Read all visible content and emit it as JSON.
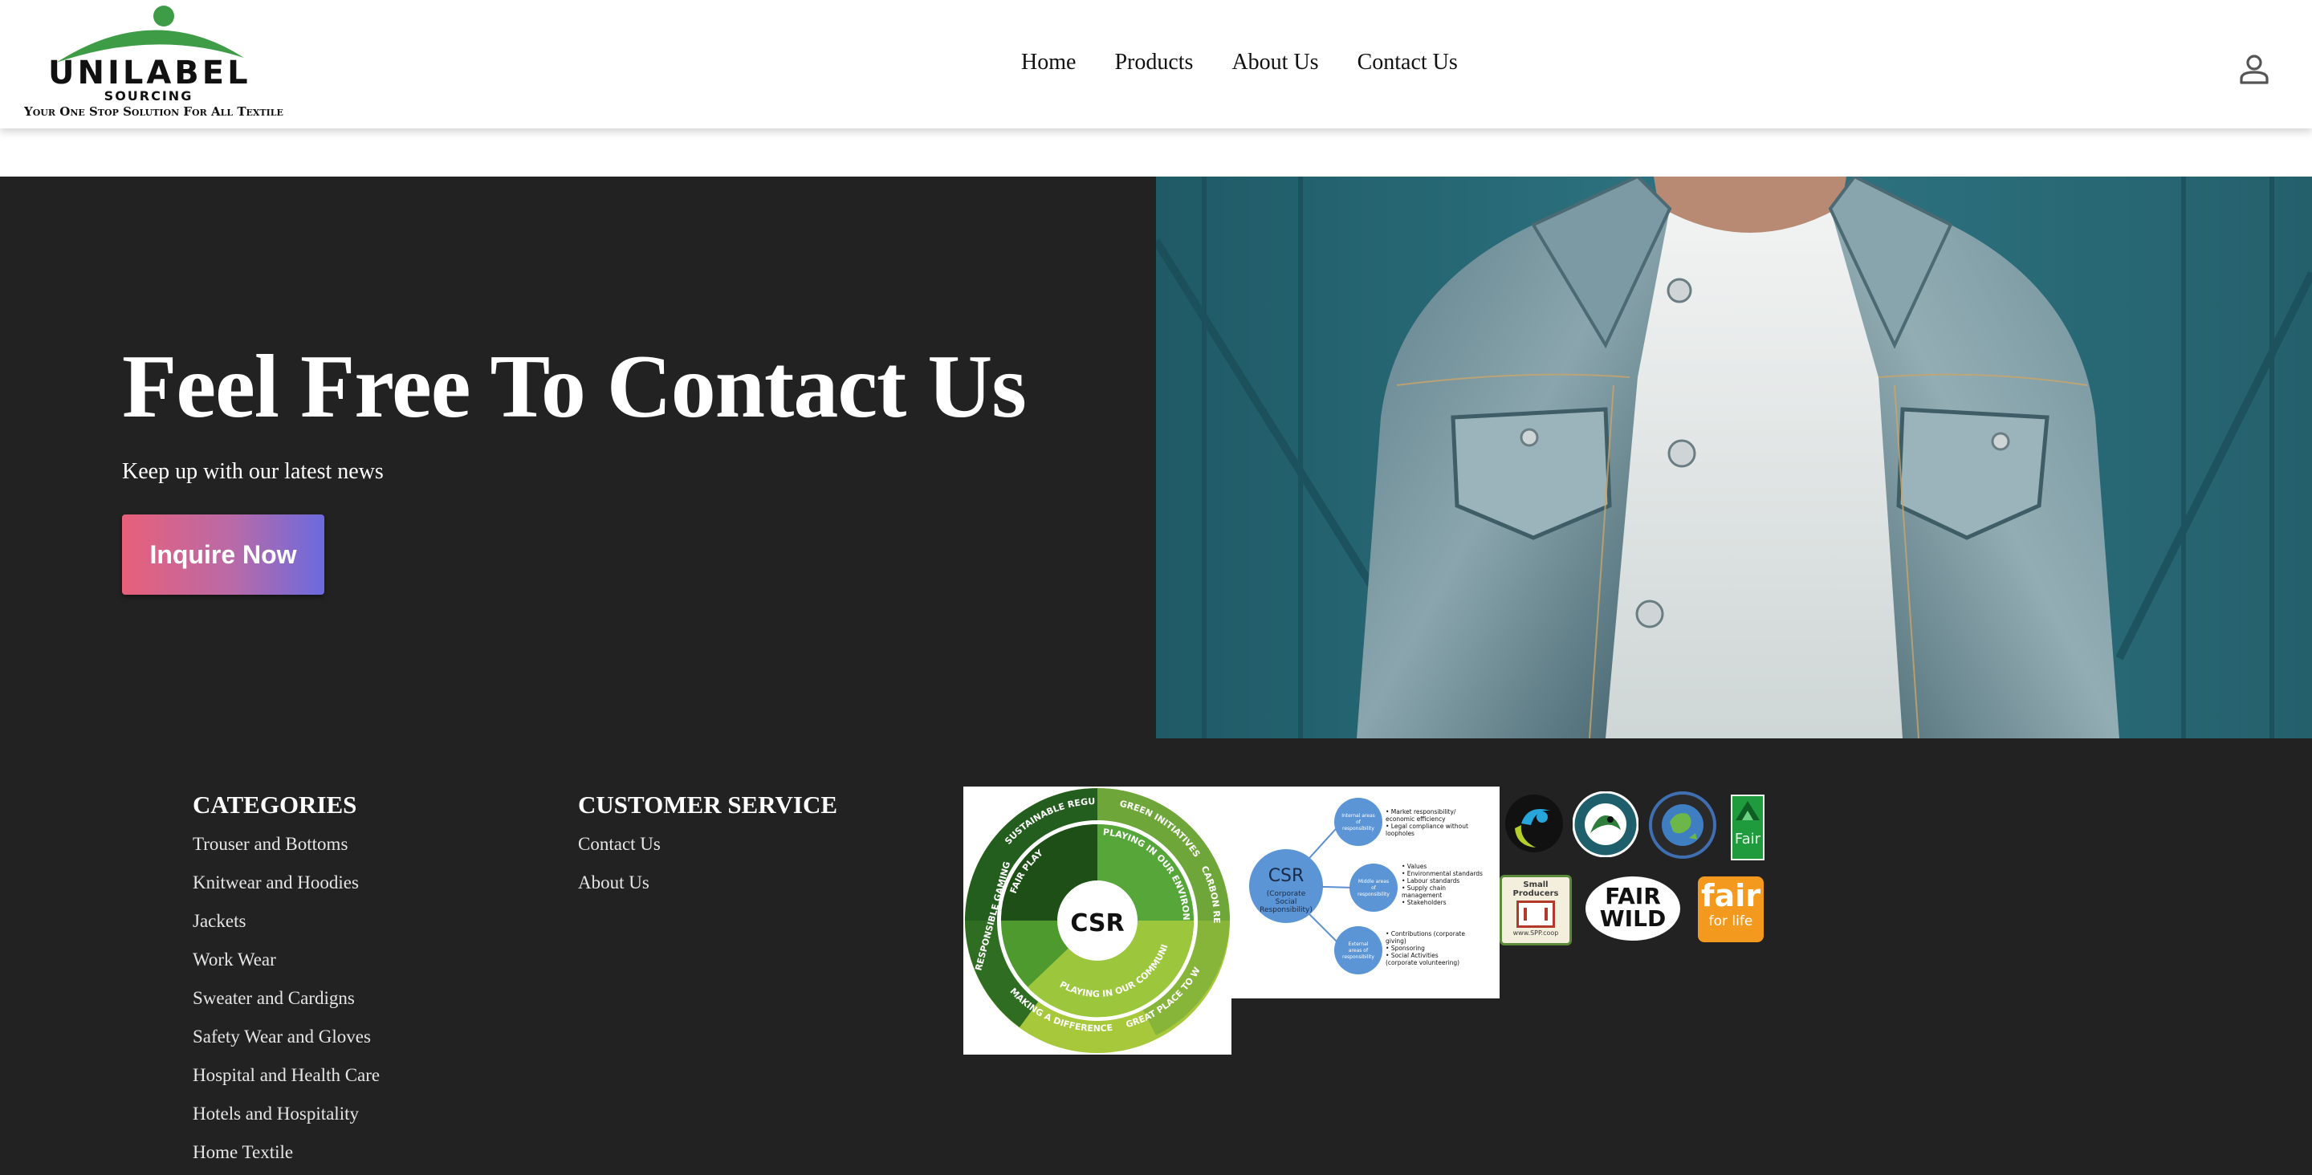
{
  "header": {
    "logo": {
      "title": "UNILABEL",
      "subtitle": "SOURCING",
      "tagline": "Your One Stop Solution For All Textile"
    },
    "nav": [
      "Home",
      "Products",
      "About Us",
      "Contact Us"
    ],
    "account_icon": "user-account-icon"
  },
  "hero": {
    "title": "Feel Free To Contact Us",
    "subtitle": "Keep up with our latest news",
    "cta_label": "Inquire Now",
    "photo": "man-in-denim-jacket-photo"
  },
  "footer": {
    "categories": {
      "heading": "CATEGORIES",
      "items": [
        "Trouser and Bottoms",
        "Knitwear and Hoodies",
        "Jackets",
        "Work Wear",
        "Sweater and Cardigns",
        "Safety Wear and Gloves",
        "Hospital and Health Care",
        "Hotels and Hospitality",
        "Home Textile"
      ]
    },
    "customer_service": {
      "heading": "CUSTOMER SERVICE",
      "items": [
        "Contact Us",
        "About Us"
      ]
    },
    "csr_wheel": {
      "center": "CSR",
      "segments": [
        "SUSTAINABLE REGULATION",
        "GREEN INITIATIVES",
        "CARBON REPORTING",
        "GREAT PLACE TO WORK",
        "MAKING A DIFFERENCE",
        "RESPONSIBLE GAMING",
        "FAIR PLAY",
        "PLAYING IN OUR ENVIRONMENT",
        "PLAYING IN OUR COMMUNITIES"
      ]
    },
    "csr_diagram": {
      "center_title": "CSR",
      "center_sub": [
        "(Corporate",
        "Social",
        "Responsibility)"
      ],
      "areas": [
        {
          "label": [
            "Internal areas",
            "of",
            "responsibility"
          ],
          "notes": [
            "• Market responsibility/",
            "  economic efficiency",
            "• Legal compliance without",
            "  loopholes"
          ]
        },
        {
          "label": [
            "Middle areas",
            "of",
            "responsibility"
          ],
          "notes": [
            "• Values",
            "• Environmental standards",
            "• Labour standards",
            "• Supply chain",
            "  management",
            "• Stakeholders"
          ]
        },
        {
          "label": [
            "External",
            "areas of",
            "responsibility"
          ],
          "notes": [
            "• Contributions (corporate",
            "  giving)",
            "• Sponsoring",
            "• Social Activities",
            "  (corporate volunteering)"
          ]
        }
      ]
    },
    "certifications": {
      "small_producers": [
        "Small",
        "Producers",
        "www.SPP.coop"
      ],
      "fairwild": [
        "FAIR",
        "WILD"
      ],
      "fair_for_life": [
        "fair",
        "for life"
      ],
      "naturland": "Fair"
    }
  }
}
